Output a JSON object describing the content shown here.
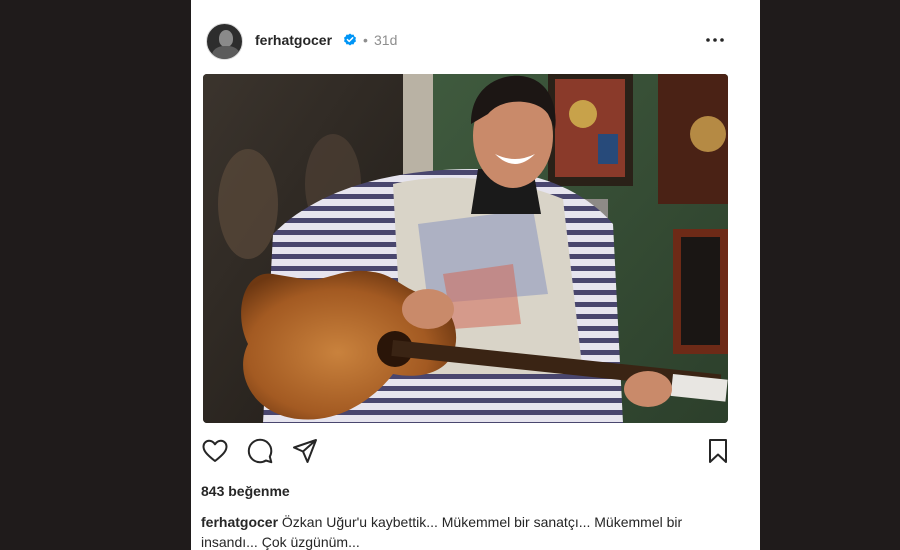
{
  "post": {
    "username": "ferhatgocer",
    "separator": "•",
    "time": "31d",
    "likes": "843 beğenme",
    "caption_user": "ferhatgocer",
    "caption_text": "Özkan Uğur'u kaybettik... Mükemmel bir sanatçı... Mükemmel bir insandı... Çok üzgünüm..."
  },
  "icons": {
    "verified": "verified-badge-icon",
    "more": "more-options-icon",
    "like": "heart-icon",
    "comment": "comment-icon",
    "share": "share-icon",
    "save": "bookmark-icon"
  },
  "colors": {
    "verified": "#0095f6",
    "background": "#1f1b1b",
    "card": "#ffffff",
    "text": "#262626",
    "muted": "#8e8e8e"
  }
}
